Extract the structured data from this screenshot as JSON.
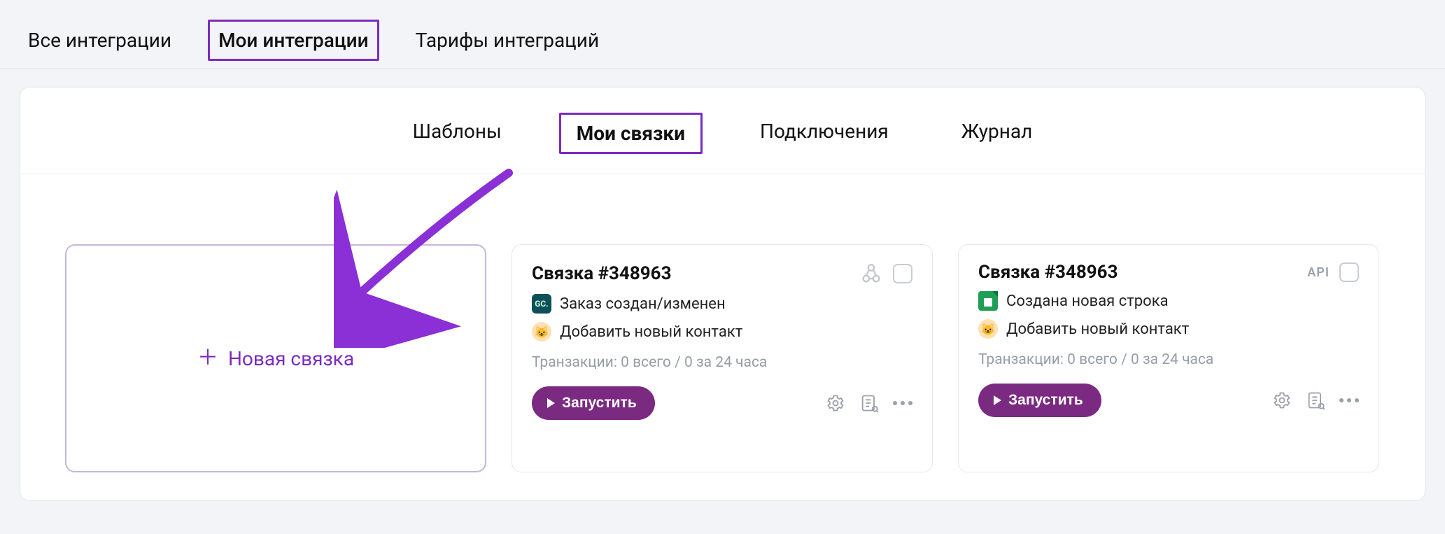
{
  "top_tabs": {
    "all": "Все интеграции",
    "mine": "Мои интеграции",
    "tariffs": "Тарифы интеграций"
  },
  "sub_tabs": {
    "templates": "Шаблоны",
    "links": "Мои связки",
    "connections": "Подключения",
    "journal": "Журнал"
  },
  "new_card": {
    "label": "Новая связка"
  },
  "cards": [
    {
      "title": "Связка #348963",
      "badge": "",
      "trigger": {
        "icon": "gc",
        "text": "Заказ создан/изменен"
      },
      "action": {
        "icon": "contact",
        "text": "Добавить новый контакт"
      },
      "tx": "Транзакции: 0 всего / 0 за 24 часа",
      "run": "Запустить",
      "header_icon": "webhook"
    },
    {
      "title": "Связка #348963",
      "badge": "API",
      "trigger": {
        "icon": "sheets",
        "text": "Создана новая строка"
      },
      "action": {
        "icon": "contact",
        "text": "Добавить новый контакт"
      },
      "tx": "Транзакции: 0 всего / 0 за 24 часа",
      "run": "Запустить",
      "header_icon": "api"
    }
  ]
}
